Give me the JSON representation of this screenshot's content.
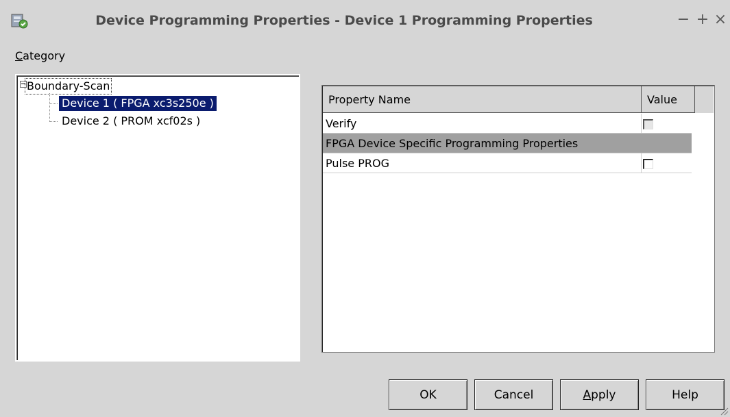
{
  "window": {
    "title": "Device Programming Properties - Device 1 Programming Properties",
    "controls": {
      "minimize": "−",
      "maximize": "+",
      "close": "×"
    }
  },
  "category": {
    "label_mnemonic": "C",
    "label_rest": "ategory"
  },
  "tree": {
    "root": "Boundary-Scan",
    "items": [
      {
        "label": "Device 1 ( FPGA xc3s250e )",
        "selected": true
      },
      {
        "label": "Device 2 ( PROM xcf02s )",
        "selected": false
      }
    ]
  },
  "properties": {
    "columns": [
      "Property Name",
      "Value"
    ],
    "rows": [
      {
        "name": "Verify",
        "type": "checkbox",
        "checked": false,
        "enabled": false
      },
      {
        "name": "FPGA Device Specific Programming Properties",
        "type": "group"
      },
      {
        "name": "Pulse PROG",
        "type": "checkbox",
        "checked": false,
        "enabled": true
      }
    ]
  },
  "buttons": {
    "ok": "OK",
    "cancel": "Cancel",
    "apply_mnemonic": "A",
    "apply_rest": "pply",
    "help": "Help"
  },
  "colors": {
    "background": "#d6d6d6",
    "selection": "#0a1b6e",
    "group_row": "#a0a0a0"
  }
}
